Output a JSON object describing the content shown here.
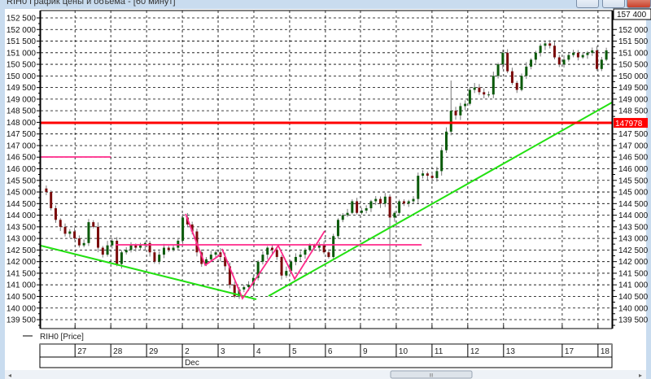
{
  "window": {
    "title": "RIH0 График цены и объема - [60 минут]",
    "scrollbar_grip": "III"
  },
  "legend": {
    "series_label": "RIH0 [Price]"
  },
  "colors": {
    "up": "#0a5a0a",
    "down": "#7a0a0a",
    "wick": "#777777",
    "support": "#22e011",
    "resistance": "#ff0000",
    "pattern": "#ff2a8a",
    "grid": "#000000"
  },
  "chart_data": {
    "type": "candlestick",
    "ylim": [
      139250,
      152900
    ],
    "xlim": [
      0,
      15.97
    ],
    "left_ticks": [
      {
        "v": 152500,
        "t": "152 500"
      },
      {
        "v": 152000,
        "t": "152 000"
      },
      {
        "v": 151500,
        "t": "151 500"
      },
      {
        "v": 151000,
        "t": "151 000"
      },
      {
        "v": 150500,
        "t": "150 500"
      },
      {
        "v": 150000,
        "t": "150 000"
      },
      {
        "v": 149500,
        "t": "149 500"
      },
      {
        "v": 149000,
        "t": "149 000"
      },
      {
        "v": 148500,
        "t": "148 500"
      },
      {
        "v": 148000,
        "t": "148 000"
      },
      {
        "v": 147500,
        "t": "147 500"
      },
      {
        "v": 147000,
        "t": "147 000"
      },
      {
        "v": 146500,
        "t": "146 500"
      },
      {
        "v": 146000,
        "t": "146 000"
      },
      {
        "v": 145500,
        "t": "145 500"
      },
      {
        "v": 145000,
        "t": "145 000"
      },
      {
        "v": 144500,
        "t": "144 500"
      },
      {
        "v": 144000,
        "t": "144 000"
      },
      {
        "v": 143500,
        "t": "143 500"
      },
      {
        "v": 143000,
        "t": "143 000"
      },
      {
        "v": 142500,
        "t": "142 500"
      },
      {
        "v": 142000,
        "t": "142 000"
      },
      {
        "v": 141500,
        "t": "141 500"
      },
      {
        "v": 141000,
        "t": "141 000"
      },
      {
        "v": 140500,
        "t": "140 500"
      },
      {
        "v": 140000,
        "t": "140 000"
      },
      {
        "v": 139500,
        "t": "139 500"
      }
    ],
    "right_top_label": "157 400",
    "right_ticks": [
      {
        "v": 152000,
        "t": "152 000"
      },
      {
        "v": 151500,
        "t": "151 500"
      },
      {
        "v": 151000,
        "t": "151 000"
      },
      {
        "v": 150500,
        "t": "150 500"
      },
      {
        "v": 150000,
        "t": "150 000"
      },
      {
        "v": 149500,
        "t": "149 500"
      },
      {
        "v": 149000,
        "t": "149 000"
      },
      {
        "v": 148500,
        "t": "148 500"
      },
      {
        "v": 147500,
        "t": "147 500"
      },
      {
        "v": 147000,
        "t": "147 000"
      },
      {
        "v": 146500,
        "t": "146 500"
      },
      {
        "v": 146000,
        "t": "146 000"
      },
      {
        "v": 145500,
        "t": "145 500"
      },
      {
        "v": 145000,
        "t": "145 000"
      },
      {
        "v": 144500,
        "t": "144 500"
      },
      {
        "v": 144000,
        "t": "144 000"
      },
      {
        "v": 143500,
        "t": "143 500"
      },
      {
        "v": 143000,
        "t": "143 000"
      },
      {
        "v": 142500,
        "t": "142 500"
      },
      {
        "v": 142000,
        "t": "142 000"
      },
      {
        "v": 141500,
        "t": "141 500"
      },
      {
        "v": 141000,
        "t": "141 000"
      },
      {
        "v": 140500,
        "t": "140 500"
      },
      {
        "v": 140000,
        "t": "140 000"
      },
      {
        "v": 139500,
        "t": "139 500"
      }
    ],
    "price_marker": {
      "value": 147978,
      "label": "147978"
    },
    "x_ticks": [
      {
        "u": 0.96,
        "t": "27"
      },
      {
        "u": 1.96,
        "t": "28"
      },
      {
        "u": 2.96,
        "t": "29"
      },
      {
        "u": 3.96,
        "t": "2"
      },
      {
        "u": 4.96,
        "t": "3"
      },
      {
        "u": 5.96,
        "t": "4"
      },
      {
        "u": 6.96,
        "t": "5"
      },
      {
        "u": 7.96,
        "t": "6"
      },
      {
        "u": 8.94,
        "t": "9"
      },
      {
        "u": 9.94,
        "t": "10"
      },
      {
        "u": 10.94,
        "t": "11"
      },
      {
        "u": 11.94,
        "t": "12"
      },
      {
        "u": 12.94,
        "t": "13"
      },
      {
        "u": 14.58,
        "t": "17"
      },
      {
        "u": 15.58,
        "t": "18"
      }
    ],
    "month_label": {
      "u": 3.96,
      "t": "Dec"
    },
    "closes": [
      145000,
      144300,
      143800,
      143500,
      143200,
      143300,
      143000,
      142700,
      142800,
      143700,
      143500,
      142600,
      142300,
      142700,
      142900,
      141900,
      142400,
      142500,
      142700,
      142600,
      142700,
      142800,
      142400,
      142000,
      142300,
      142600,
      142500,
      142600,
      142900,
      143900,
      143600,
      143300,
      142400,
      141900,
      142100,
      142300,
      142400,
      142200,
      141800,
      141000,
      140500,
      140800,
      140900,
      141000,
      141300,
      142000,
      142300,
      142600,
      142500,
      142200,
      141400,
      141600,
      142000,
      142200,
      142300,
      142500,
      142700,
      142600,
      142700,
      142400,
      142200,
      143100,
      143800,
      144000,
      144100,
      144600,
      144100,
      144200,
      144300,
      144600,
      144700,
      144500,
      144800,
      143900,
      144100,
      144600,
      144500,
      144600,
      144700,
      145700,
      145800,
      145700,
      145600,
      145900,
      146800,
      147600,
      148500,
      148300,
      148700,
      148800,
      149400,
      149500,
      149300,
      149200,
      149200,
      150000,
      150500,
      151000,
      150200,
      149700,
      149400,
      150000,
      150400,
      150700,
      151000,
      151300,
      151400,
      151300,
      150800,
      150500,
      150700,
      150900,
      151000,
      150800,
      150900,
      151000,
      151100,
      150300,
      150700,
      151100
    ],
    "spikes": [
      {
        "index": 73,
        "low": 141300
      },
      {
        "index": 86,
        "high": 149800
      }
    ],
    "lines": [
      {
        "kind": "support",
        "points": [
          [
            0,
            142690
          ],
          [
            6.03,
            140376
          ]
        ]
      },
      {
        "kind": "support",
        "points": [
          [
            6.37,
            140516
          ],
          [
            15.97,
            148856
          ]
        ]
      },
      {
        "kind": "resistance",
        "points": [
          [
            0,
            147978
          ],
          [
            15.97,
            147978
          ]
        ]
      },
      {
        "kind": "pattern",
        "points": [
          [
            0,
            146509
          ],
          [
            1.96,
            146509
          ]
        ]
      },
      {
        "kind": "pattern",
        "points": [
          [
            2.09,
            142724
          ],
          [
            10.65,
            142724
          ]
        ]
      },
      {
        "kind": "pattern",
        "points": [
          [
            4.05,
            144056
          ],
          [
            4.6,
            141848
          ],
          [
            5.03,
            142304
          ]
        ]
      },
      {
        "kind": "pattern",
        "points": [
          [
            5.07,
            142549
          ],
          [
            5.64,
            140411
          ],
          [
            6.64,
            142689
          ],
          [
            7.1,
            141252
          ],
          [
            7.94,
            143320
          ]
        ]
      }
    ]
  }
}
